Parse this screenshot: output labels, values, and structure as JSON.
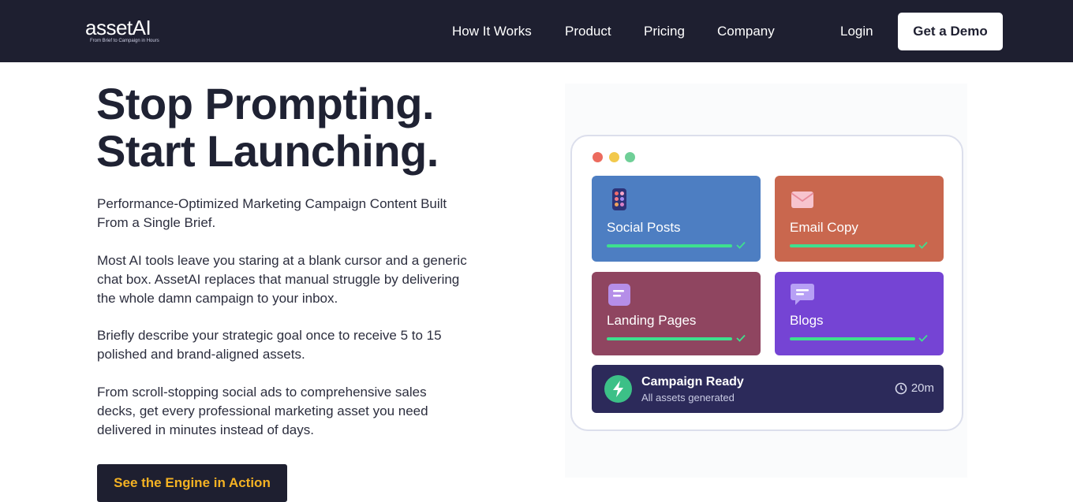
{
  "brand": {
    "name": "assetAI",
    "tagline": "From Brief to Campaign in Hours"
  },
  "nav": {
    "links": [
      "How It Works",
      "Product",
      "Pricing",
      "Company"
    ],
    "login": "Login",
    "demo": "Get a Demo"
  },
  "hero": {
    "headline_line1": "Stop Prompting.",
    "headline_line2": "Start Launching.",
    "paragraphs": [
      "Performance-Optimized Marketing Campaign Content Built From a Single Brief.",
      "Most AI tools leave you staring at a blank cursor and a generic chat box. AssetAI replaces that manual struggle by delivering the whole damn campaign to your inbox.",
      "Briefly describe your strategic goal once to receive 5 to 15 polished and brand-aligned assets.",
      "From scroll-stopping social ads to comprehensive sales decks, get every professional marketing asset you need delivered in minutes instead of days."
    ],
    "cta": "See the Engine in Action"
  },
  "illustration": {
    "cards": [
      {
        "label": "Social Posts",
        "icon": "phone-apps-icon",
        "color": "#4d7ec2"
      },
      {
        "label": "Email Copy",
        "icon": "envelope-icon",
        "color": "#c9674e"
      },
      {
        "label": "Landing Pages",
        "icon": "document-icon",
        "color": "#8f4560"
      },
      {
        "label": "Blogs",
        "icon": "chat-bubble-icon",
        "color": "#7544d4"
      }
    ],
    "status": {
      "title": "Campaign Ready",
      "subtitle": "All assets generated",
      "time": "20m"
    }
  }
}
